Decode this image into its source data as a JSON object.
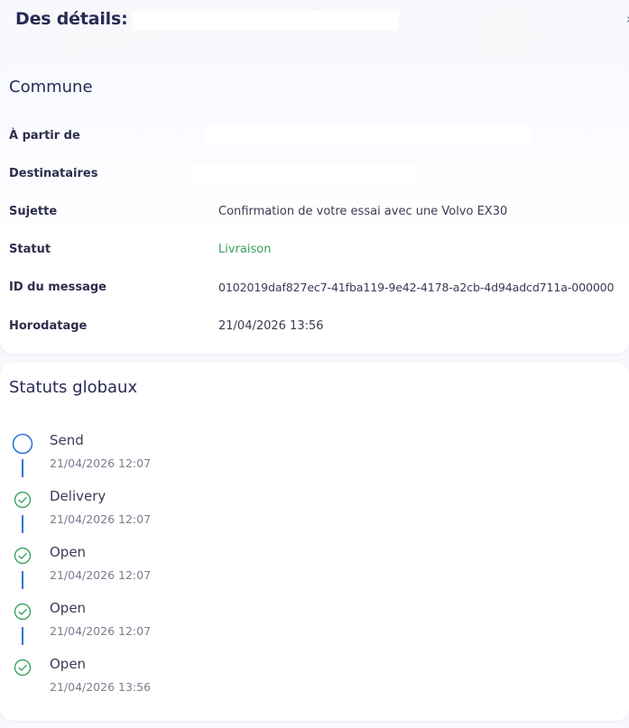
{
  "header": {
    "title": "Des détails:",
    "close_icon": "chevron-right-icon",
    "close_glyph": "›"
  },
  "common": {
    "title": "Commune",
    "rows": [
      {
        "label": "À partir de",
        "value": ""
      },
      {
        "label": "Destinataires",
        "value": ""
      },
      {
        "label": "Sujette",
        "value": "Confirmation de votre essai avec une Volvo EX30"
      },
      {
        "label": "Statut",
        "value": "Livraison"
      },
      {
        "label": "ID du message",
        "value": "0102019daf827ec7-41fba119-9e42-4178-a2cb-4d94adcd711a-000000"
      },
      {
        "label": "Horodatage",
        "value": "21/04/2026 13:56"
      }
    ]
  },
  "global_statuses": {
    "title": "Statuts globaux",
    "items": [
      {
        "label": "Send",
        "date": "21/04/2026 12:07",
        "icon": "open-circle-icon"
      },
      {
        "label": "Delivery",
        "date": "21/04/2026 12:07",
        "icon": "check-circle-icon"
      },
      {
        "label": "Open",
        "date": "21/04/2026 12:07",
        "icon": "check-circle-icon"
      },
      {
        "label": "Open",
        "date": "21/04/2026 12:07",
        "icon": "check-circle-icon"
      },
      {
        "label": "Open",
        "date": "21/04/2026 13:56",
        "icon": "check-circle-icon"
      }
    ]
  },
  "colors": {
    "status_green": "#3aa05f",
    "timeline_blue": "#2f74d8",
    "title_navy": "#2a2a55"
  }
}
